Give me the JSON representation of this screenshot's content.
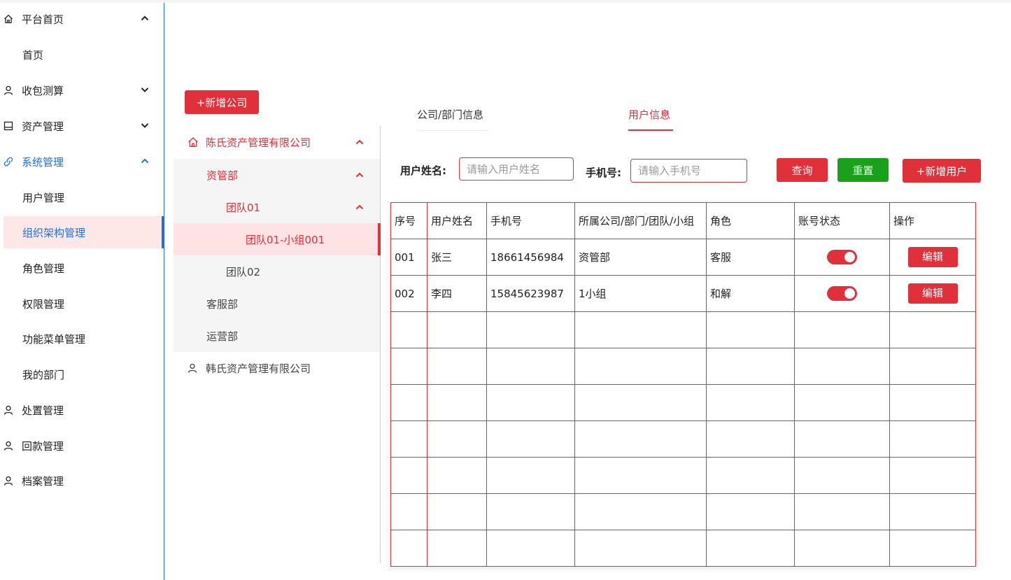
{
  "sidebar": {
    "items": [
      {
        "label": "平台首页",
        "icon": "home-icon",
        "expanded": true
      },
      {
        "label": "首页"
      },
      {
        "label": "收包测算",
        "icon": "user-icon",
        "expanded": false
      },
      {
        "label": "资产管理",
        "icon": "box-icon",
        "expanded": false
      },
      {
        "label": "系统管理",
        "icon": "link-icon",
        "expanded": true
      },
      {
        "label": "用户管理"
      },
      {
        "label": "组织架构管理",
        "active": true
      },
      {
        "label": "角色管理"
      },
      {
        "label": "权限管理"
      },
      {
        "label": "功能菜单管理"
      },
      {
        "label": "我的部门"
      },
      {
        "label": "处置管理",
        "icon": "user-icon"
      },
      {
        "label": "回款管理",
        "icon": "user-icon"
      },
      {
        "label": "档案管理",
        "icon": "user-icon"
      }
    ]
  },
  "tree": {
    "add_company_label": "+新增公司",
    "nodes": [
      {
        "label": "陈氏资产管理有限公司",
        "level": 0
      },
      {
        "label": "资管部",
        "level": 1
      },
      {
        "label": "团队01",
        "level": 2
      },
      {
        "label": "团队01-小组001",
        "level": 3,
        "selected": true
      },
      {
        "label": "团队02",
        "level": 2
      },
      {
        "label": "客服部",
        "level": 1
      },
      {
        "label": "运营部",
        "level": 1
      },
      {
        "label": "韩氏资产管理有限公司",
        "level": 0
      }
    ]
  },
  "tabs": [
    {
      "label": "公司/部门信息",
      "active": false
    },
    {
      "label": "用户信息",
      "active": true
    }
  ],
  "filter": {
    "name_label": "用户姓名:",
    "name_placeholder": "请输入用户姓名",
    "phone_label": "手机号:",
    "phone_placeholder": "请输入手机号",
    "query_label": "查询",
    "reset_label": "重置",
    "add_user_label": "+新增用户"
  },
  "table": {
    "headers": [
      "序号",
      "用户姓名",
      "手机号",
      "所属公司/部门/团队/小组",
      "角色",
      "账号状态",
      "操作"
    ],
    "rows": [
      {
        "no": "001",
        "name": "张三",
        "phone": "18661456984",
        "org": "资管部",
        "role": "客服",
        "enabled": true,
        "action": "编辑"
      },
      {
        "no": "002",
        "name": "李四",
        "phone": "15845623987",
        "org": "1小组",
        "role": "和解",
        "enabled": true,
        "action": "编辑"
      }
    ]
  },
  "colors": {
    "accent": "#e0303a",
    "blue": "#1e6fe6",
    "green": "#1aa01a",
    "selected_bg": "#fde3e3"
  }
}
